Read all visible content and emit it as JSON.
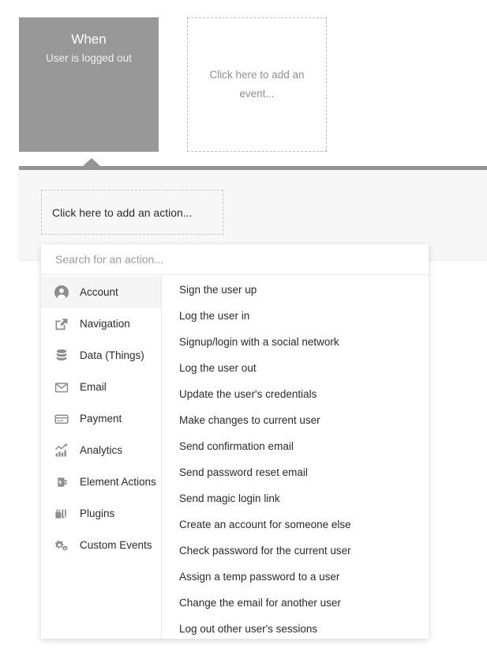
{
  "workflow": {
    "when_box": {
      "title": "When",
      "subtitle": "User is logged out",
      "bg_color": "#989898"
    },
    "event_placeholder": {
      "text": "Click here to add an event..."
    }
  },
  "action_card": {
    "topbar_color": "#949494",
    "add_action_placeholder": "Click here to add an action..."
  },
  "dropdown": {
    "search": {
      "placeholder": "Search for an action...",
      "value": ""
    },
    "categories": [
      {
        "label": "Account",
        "icon": "account-circle-icon",
        "selected": true
      },
      {
        "label": "Navigation",
        "icon": "external-link-icon",
        "selected": false
      },
      {
        "label": "Data (Things)",
        "icon": "database-icon",
        "selected": false
      },
      {
        "label": "Email",
        "icon": "envelope-icon",
        "selected": false
      },
      {
        "label": "Payment",
        "icon": "credit-card-icon",
        "selected": false
      },
      {
        "label": "Analytics",
        "icon": "bar-chart-icon",
        "selected": false
      },
      {
        "label": "Element Actions",
        "icon": "plug-bolt-icon",
        "selected": false
      },
      {
        "label": "Plugins",
        "icon": "plugins-icon",
        "selected": false
      },
      {
        "label": "Custom Events",
        "icon": "gears-icon",
        "selected": false
      }
    ],
    "actions": [
      "Sign the user up",
      "Log the user in",
      "Signup/login with a social network",
      "Log the user out",
      "Update the user's credentials",
      "Make changes to current user",
      "Send confirmation email",
      "Send password reset email",
      "Send magic login link",
      "Create an account for someone else",
      "Check password for the current user",
      "Assign a temp password to a user",
      "Change the email for another user",
      "Log out other user's sessions"
    ]
  },
  "colors": {
    "when_box": "#989898",
    "card_topbar": "#949494",
    "selected_row": "#f5f5f5",
    "card_bg": "#f7f7f7"
  }
}
